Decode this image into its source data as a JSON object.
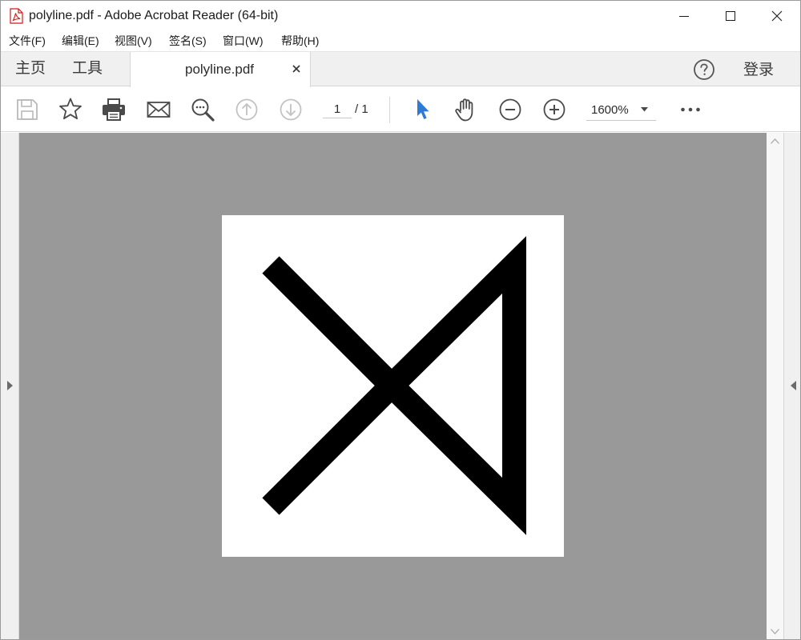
{
  "window": {
    "title": "polyline.pdf - Adobe Acrobat Reader (64-bit)"
  },
  "menu": [
    {
      "label": "文件(F)"
    },
    {
      "label": "编辑(E)"
    },
    {
      "label": "视图(V)"
    },
    {
      "label": "签名(S)"
    },
    {
      "label": "窗口(W)"
    },
    {
      "label": "帮助(H)"
    }
  ],
  "tabs": {
    "home": "主页",
    "tools": "工具",
    "document": "polyline.pdf",
    "close_glyph": "×",
    "signin": "登录"
  },
  "toolbar": {
    "page_current": "1",
    "page_total": "/ 1",
    "zoom": "1600%",
    "accent_color": "#2d7bd6"
  },
  "document": {
    "page_background": "#ffffff",
    "viewport_background": "#999999",
    "drawing_color": "#000000"
  }
}
